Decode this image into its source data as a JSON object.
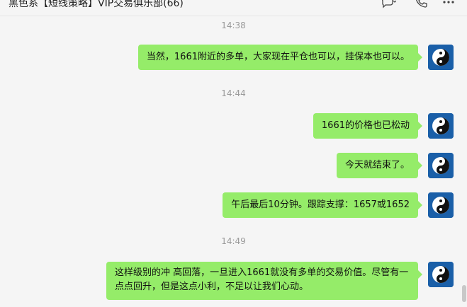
{
  "window": {
    "title": "黑色系【短线策略】VIP交易俱乐部(66)"
  },
  "icons": {
    "chat": "chat-bubble-icon",
    "call": "phone-icon",
    "more": "more-icon"
  },
  "messages": [
    {
      "time": "14:38",
      "text": "当然，1661附近的多单，大家现在平仓也可以，挂保本也可以。"
    },
    {
      "time": "14:44",
      "text": "1661的价格也已松动"
    },
    {
      "text": "今天就结束了。"
    },
    {
      "text": "午后最后10分钟。跟踪支撑：1657或1652"
    },
    {
      "time": "14:49",
      "text": "这样级别的冲 高回落，一旦进入1661就没有多单的交易价值。尽管有一点点回升，但是这点小利，不足以让我们心动。"
    }
  ],
  "colors": {
    "bubble": "#95ec69",
    "background": "#f5f5f5",
    "timestamp": "#9a9a9a",
    "avatar": "#1a5fa8"
  }
}
